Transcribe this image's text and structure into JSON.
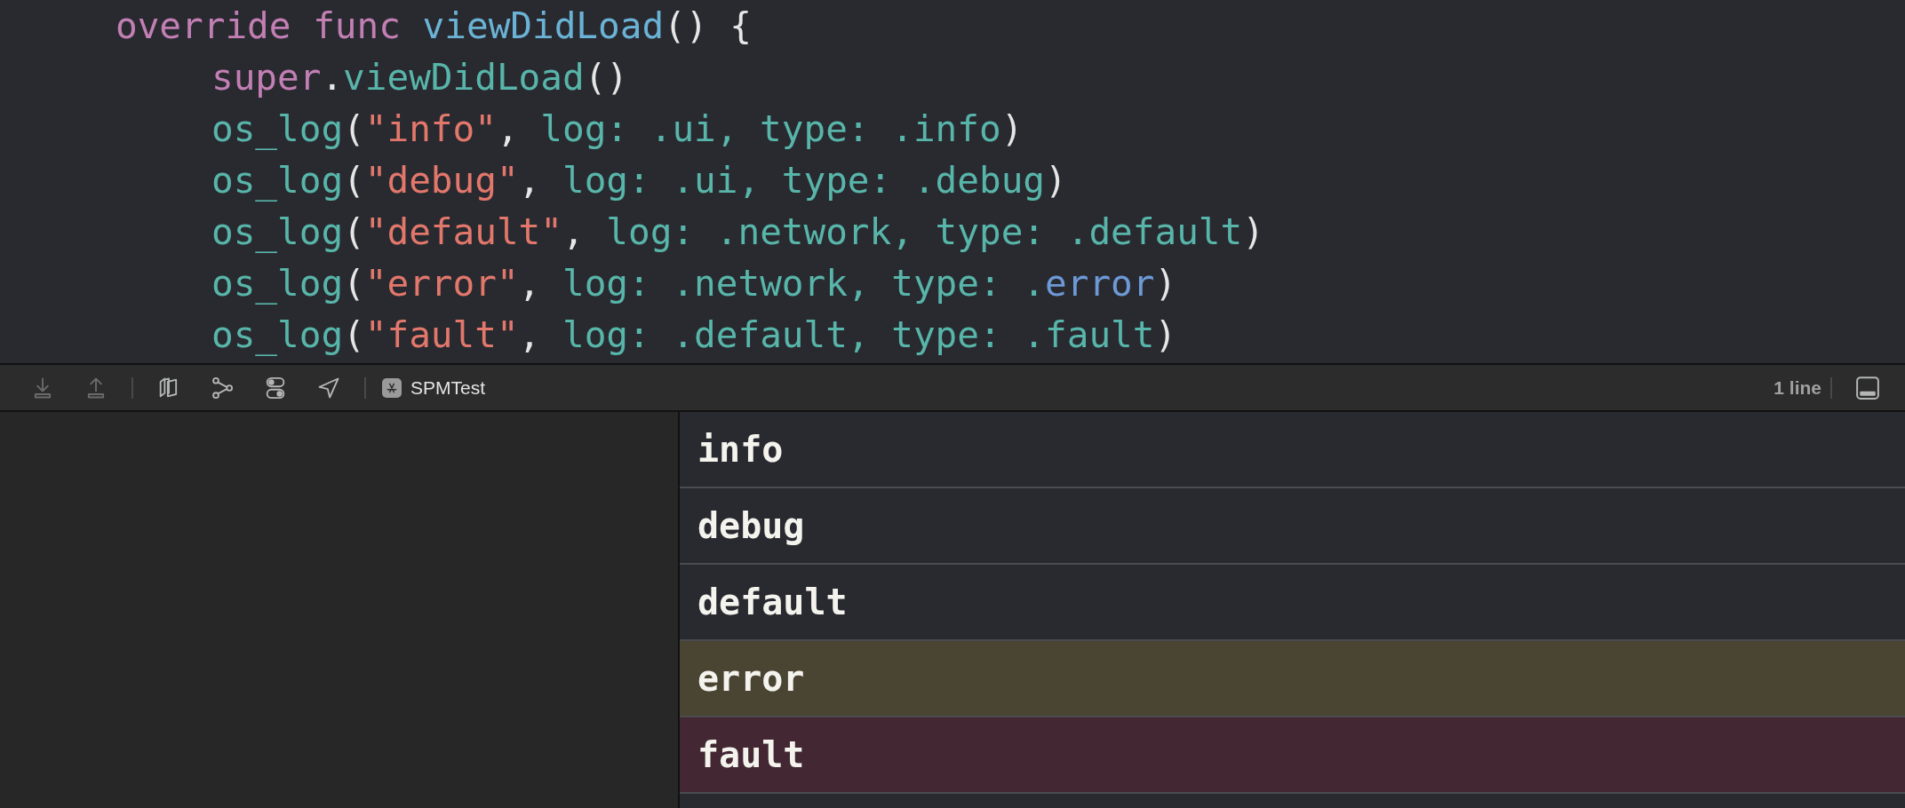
{
  "editor": {
    "lines": [
      {
        "tokens": [
          {
            "text": "override func ",
            "kind": "keyword"
          },
          {
            "text": "viewDidLoad",
            "kind": "declaration"
          },
          {
            "text": "() {",
            "kind": "plain"
          }
        ],
        "children": [
          {
            "tokens": [
              {
                "text": "super",
                "kind": "keyword"
              },
              {
                "text": ".",
                "kind": "plain"
              },
              {
                "text": "viewDidLoad",
                "kind": "call"
              },
              {
                "text": "()",
                "kind": "plain"
              }
            ]
          },
          {
            "tokens": [
              {
                "text": "os_log",
                "kind": "call"
              },
              {
                "text": "(",
                "kind": "plain"
              },
              {
                "text": "\"info\"",
                "kind": "string"
              },
              {
                "text": ", ",
                "kind": "plain"
              },
              {
                "text": "log: .ui, type: .info",
                "kind": "call"
              },
              {
                "text": ")",
                "kind": "plain"
              }
            ]
          },
          {
            "tokens": [
              {
                "text": "os_log",
                "kind": "call"
              },
              {
                "text": "(",
                "kind": "plain"
              },
              {
                "text": "\"debug\"",
                "kind": "string"
              },
              {
                "text": ", ",
                "kind": "plain"
              },
              {
                "text": "log: .ui, type: .debug",
                "kind": "call"
              },
              {
                "text": ")",
                "kind": "plain"
              }
            ]
          },
          {
            "tokens": [
              {
                "text": "os_log",
                "kind": "call"
              },
              {
                "text": "(",
                "kind": "plain"
              },
              {
                "text": "\"default\"",
                "kind": "string"
              },
              {
                "text": ", ",
                "kind": "plain"
              },
              {
                "text": "log: .network, type: .default",
                "kind": "call"
              },
              {
                "text": ")",
                "kind": "plain"
              }
            ]
          },
          {
            "tokens": [
              {
                "text": "os_log",
                "kind": "call"
              },
              {
                "text": "(",
                "kind": "plain"
              },
              {
                "text": "\"error\"",
                "kind": "string"
              },
              {
                "text": ", ",
                "kind": "plain"
              },
              {
                "text": "log: .network, type: .",
                "kind": "call"
              },
              {
                "text": "error",
                "kind": "enum"
              },
              {
                "text": ")",
                "kind": "plain"
              }
            ]
          },
          {
            "tokens": [
              {
                "text": "os_log",
                "kind": "call"
              },
              {
                "text": "(",
                "kind": "plain"
              },
              {
                "text": "\"fault\"",
                "kind": "string"
              },
              {
                "text": ", ",
                "kind": "plain"
              },
              {
                "text": "log: .default, type: .fault",
                "kind": "call"
              },
              {
                "text": ")",
                "kind": "plain"
              }
            ]
          }
        ]
      }
    ]
  },
  "toolbar": {
    "buttons": [
      {
        "kind": "download",
        "disabled": true
      },
      {
        "kind": "upload",
        "disabled": true
      },
      {
        "kind": "separator"
      },
      {
        "kind": "layers",
        "disabled": false
      },
      {
        "kind": "graph",
        "disabled": false
      },
      {
        "kind": "toggles",
        "disabled": false
      },
      {
        "kind": "location",
        "disabled": false
      },
      {
        "kind": "separator"
      }
    ],
    "scheme": "SPMTest",
    "line_count": "1 line"
  },
  "console": {
    "rows": [
      {
        "text": "info",
        "kind": "plain"
      },
      {
        "text": "debug",
        "kind": "plain"
      },
      {
        "text": "default",
        "kind": "plain"
      },
      {
        "text": "error",
        "kind": "error"
      },
      {
        "text": "fault",
        "kind": "fault"
      }
    ]
  }
}
